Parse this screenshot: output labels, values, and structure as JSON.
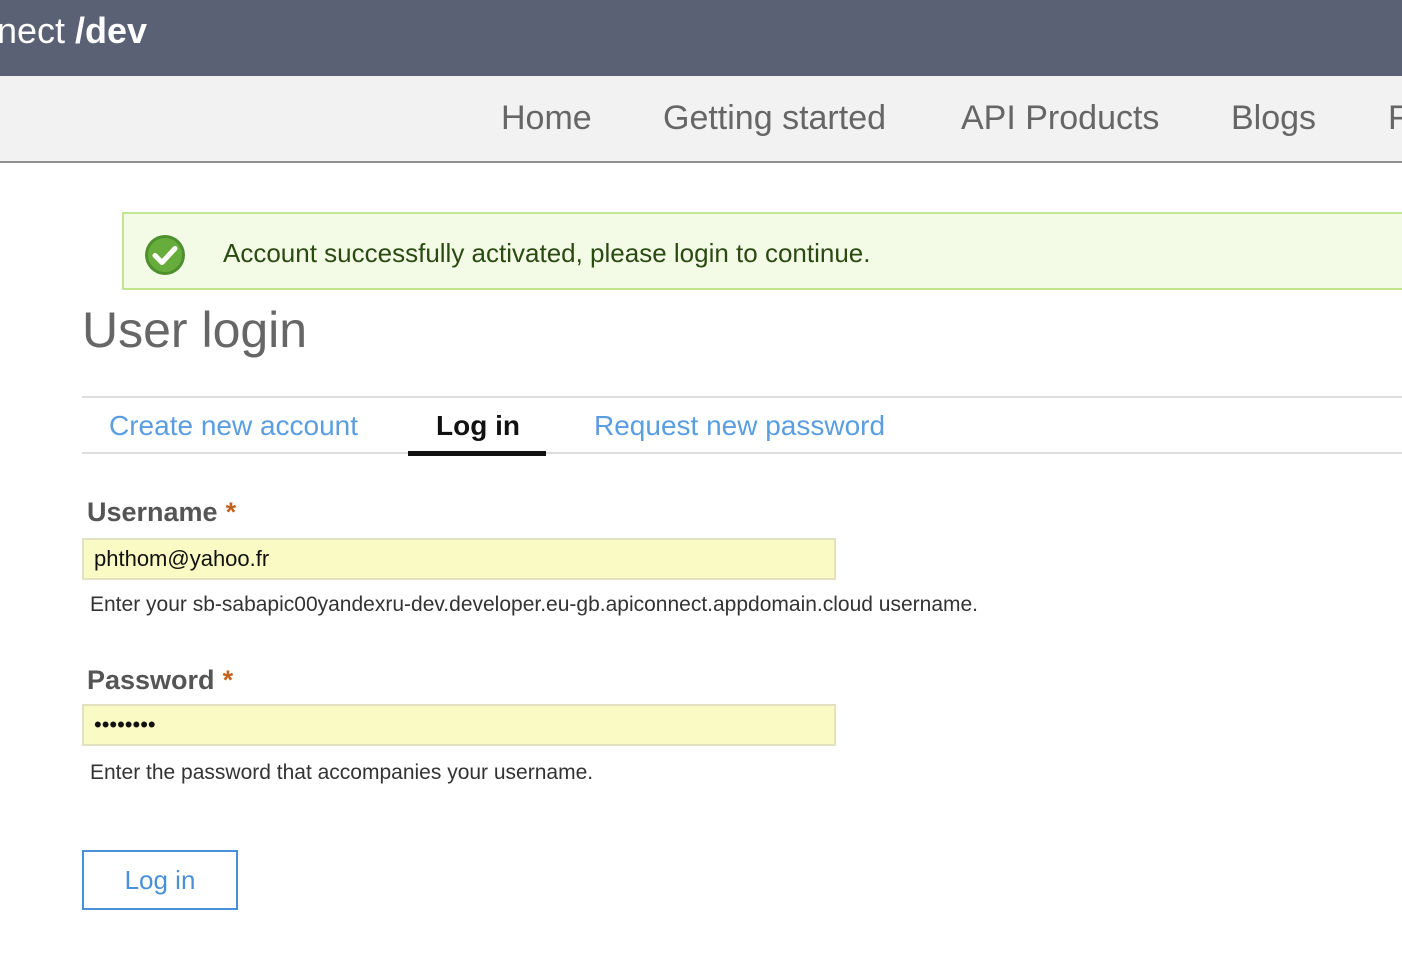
{
  "header": {
    "brand_prefix": "nect",
    "brand_suffix": "/dev",
    "background_color": "#5b6174"
  },
  "nav": {
    "items": [
      {
        "label": "Home"
      },
      {
        "label": "Getting started"
      },
      {
        "label": "API Products"
      },
      {
        "label": "Blogs"
      },
      {
        "label": "F"
      }
    ]
  },
  "status": {
    "icon": "checkmark-circle-icon",
    "message": "Account successfully activated, please login to continue."
  },
  "page": {
    "title": "User login"
  },
  "tabs": [
    {
      "label": "Create new account",
      "active": false
    },
    {
      "label": "Log in",
      "active": true
    },
    {
      "label": "Request new password",
      "active": false
    }
  ],
  "form": {
    "username": {
      "label": "Username",
      "required_marker": "*",
      "value": "phthom@yahoo.fr",
      "description": "Enter your sb-sabapic00yandexru-dev.developer.eu-gb.apiconnect.appdomain.cloud username."
    },
    "password": {
      "label": "Password",
      "required_marker": "*",
      "value": "••••••••",
      "description": "Enter the password that accompanies your username."
    },
    "submit_label": "Log in"
  },
  "colors": {
    "link": "#5a9ee0",
    "required": "#c1621c",
    "status_border": "#c2e58f",
    "status_background": "#f3fbe7",
    "input_background": "#fafac5",
    "button_border": "#4a90d9"
  }
}
